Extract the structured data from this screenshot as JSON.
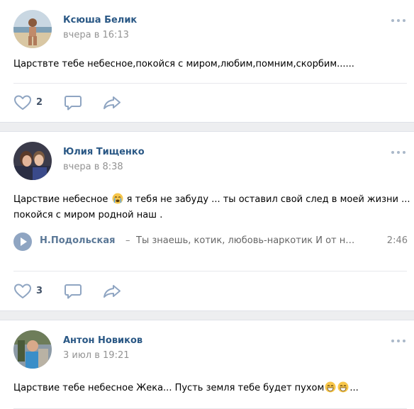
{
  "posts": [
    {
      "author": "Ксюша Белик",
      "date": "вчера в 16:13",
      "text": "Царствте тебе небесное,покойся с миром,любим,помним,скорбим......",
      "likes": "2"
    },
    {
      "author": "Юлия Тищенко",
      "date": "вчера в 8:38",
      "text_part1": "Царствие небесное",
      "text_part2": " я тебя не забуду ... ты оставил свой след в моей жизни ...",
      "text_line2": "покойся с миром родной наш .",
      "audio": {
        "artist": "Н.Подольская",
        "dash": "–",
        "title": "Ты знаешь, котик, любовь-наркотик И от неё...",
        "duration": "2:46"
      },
      "likes": "3"
    },
    {
      "author": "Антон Новиков",
      "date": "3 июл в 19:21",
      "text": "Царствие тебе небесное Жека... Пусть земля тебе будет пухом",
      "text_tail": "..."
    }
  ],
  "icons": {
    "like": "heart-outline-icon",
    "comment": "speech-bubble-icon",
    "share": "share-arrow-icon",
    "more": "more-dots-icon",
    "play": "play-icon",
    "emoji_cry": "crying-face-emoji-icon",
    "emoji_grin": "grinning-face-emoji-icon"
  },
  "colors": {
    "author_link": "#2a5885",
    "date": "#939393",
    "separator": "#edeef0",
    "icon": "#8fa5c2",
    "like_count": "#44546a"
  }
}
